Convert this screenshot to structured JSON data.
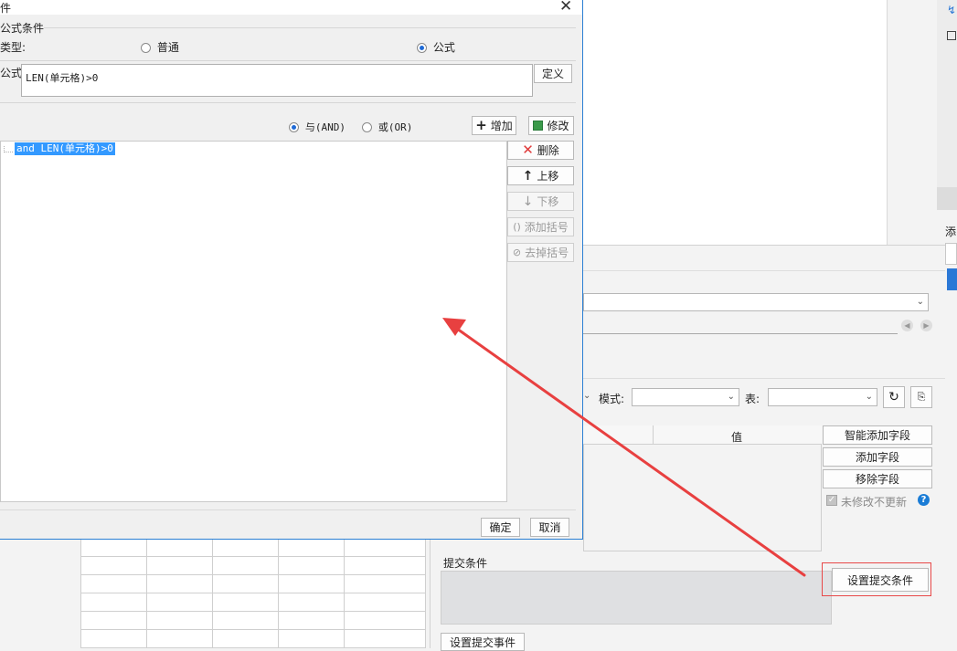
{
  "dialog": {
    "title": "件",
    "section_formula_condition": "公式条件",
    "type_label": "类型:",
    "type_options": [
      {
        "label": "普通",
        "selected": false
      },
      {
        "label": "公式",
        "selected": true
      }
    ],
    "formula_label": "公式=",
    "formula_value": "LEN(单元格)>0",
    "define_button": "定义",
    "logic_options": [
      {
        "label": "与(AND)",
        "selected": true
      },
      {
        "label": "或(OR)",
        "selected": false
      }
    ],
    "add_button": "增加",
    "modify_button": "修改",
    "condition_items": [
      "and LEN(单元格)>0"
    ],
    "side_buttons": {
      "delete": "删除",
      "move_up": "上移",
      "move_down": "下移",
      "add_bracket": "添加括号",
      "remove_bracket": "去掉括号"
    },
    "ok_button": "确定",
    "cancel_button": "取消"
  },
  "background": {
    "right_edge_label": "添",
    "mode_label": "模式:",
    "table_label": "表:",
    "value_column_header": "值",
    "smart_add_field": "智能添加字段",
    "add_field": "添加字段",
    "remove_field": "移除字段",
    "unmodified_no_update": "未修改不更新",
    "submit_condition_label": "提交条件",
    "set_submit_condition": "设置提交条件",
    "set_submit_event": "设置提交事件"
  },
  "colors": {
    "accent": "#1f6ad6",
    "selection": "#3399ff",
    "arrow": "#e84040",
    "help_icon": "#1a7cd6"
  }
}
